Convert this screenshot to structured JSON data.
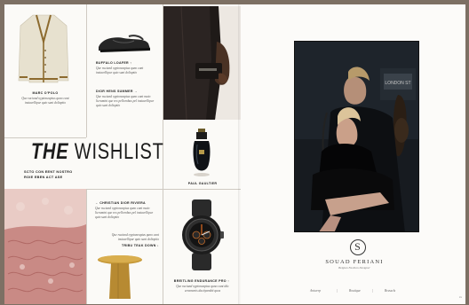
{
  "left_page": {
    "title": {
      "lead": "THE",
      "rest": "WISHLIST"
    },
    "subtitle_line1": "SCTO CON EENT NOSTRO",
    "subtitle_line2": "ROIE EBEN ACT ASE",
    "items": {
      "cardigan": {
        "caption": "MARC O'POLO",
        "body": "Que ruciand oyptoneaptus quno cant instavellipur quio sunt dolioptio"
      },
      "loafer": {
        "caption": "BUFFALO LOAFER ↑",
        "body": "Que ruciand oyptoneaptus quno cant instavellipur quio sunt dolioptio"
      },
      "sneaker": {
        "caption": "DIOR HENS SUMMER →",
        "body": "Que ruciand oyptoneaptus quno cant maio licramint que rex pellorobus pel instavellipur quio sunt dolioptio"
      },
      "perfume": {
        "caption": "PAUL GAULTIER"
      },
      "rug": {
        "caption": "← CHRISTIAN DIOR RIVIERA",
        "body": "Que ruciand oyptoneaptus quno cant maio licramint que rex pellorobus pel instavellipur quio sunt dolioptio"
      },
      "table": {
        "caption": "TRIBU TEAK DOWN ↓",
        "body": "Que ruciand oyptoneaptus quno cant instavellipur quio sunt dolioptio"
      },
      "watch": {
        "caption": "BREITLING ENDURANCE PRO ↑",
        "body": "Que ruciand oyptoneaptus quno cant idic ceramenis dacityambit quos"
      }
    }
  },
  "right_page": {
    "photo_sign": "LONDON ST",
    "logo_letter": "S",
    "brand_name": "SOUAD FERIANI",
    "brand_tagline": "Belgian Fashion Designer",
    "links": [
      "Antwerp",
      "Boutique",
      "Brussels"
    ],
    "separator": "|",
    "page_number": "xx"
  }
}
